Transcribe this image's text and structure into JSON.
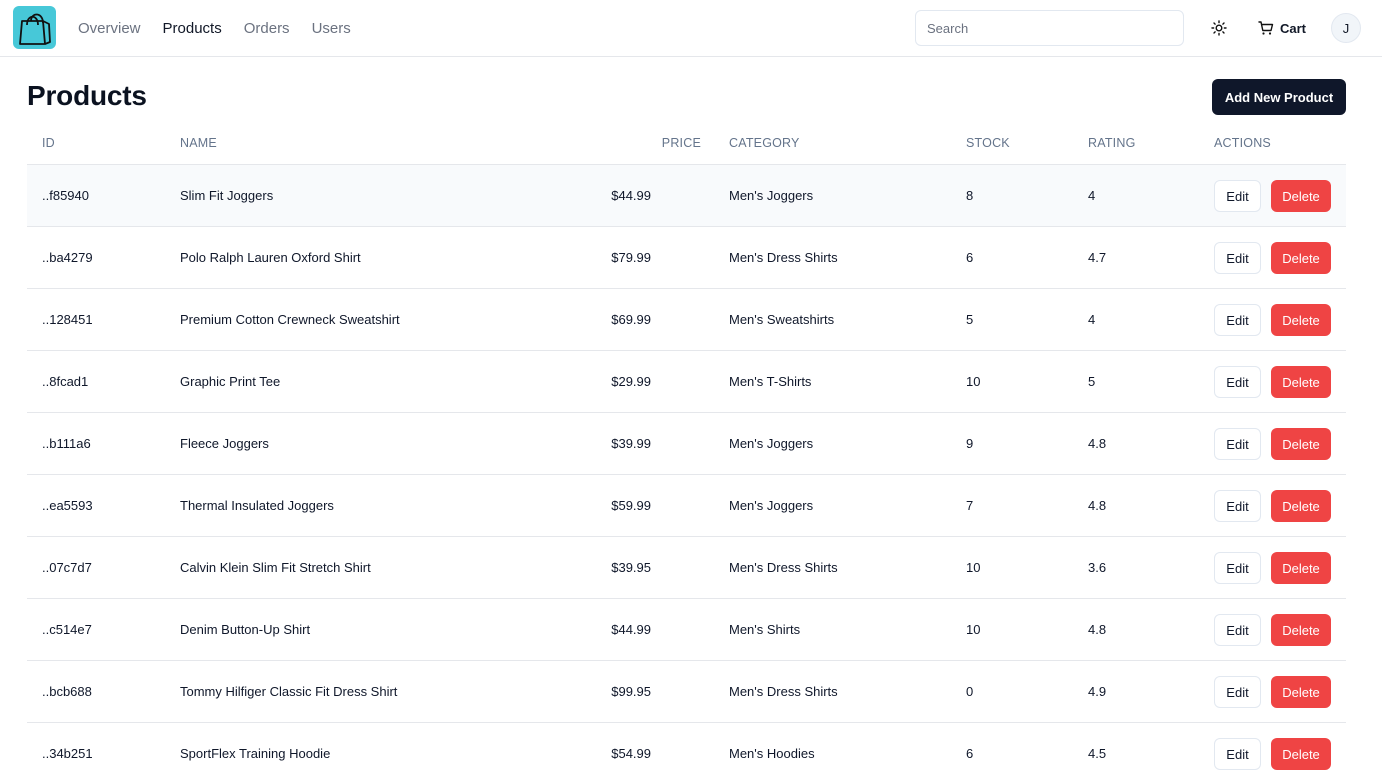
{
  "header": {
    "logo_icon": "shopping-bag-icon",
    "nav": [
      {
        "label": "Overview",
        "active": false
      },
      {
        "label": "Products",
        "active": true
      },
      {
        "label": "Orders",
        "active": false
      },
      {
        "label": "Users",
        "active": false
      }
    ],
    "search_placeholder": "Search",
    "theme_icon": "sun-icon",
    "cart_label": "Cart",
    "avatar_initial": "J"
  },
  "page": {
    "title": "Products",
    "add_button": "Add New Product"
  },
  "table": {
    "columns": [
      "ID",
      "NAME",
      "PRICE",
      "CATEGORY",
      "STOCK",
      "RATING",
      "ACTIONS"
    ],
    "edit_label": "Edit",
    "delete_label": "Delete",
    "rows": [
      {
        "id": "..f85940",
        "name": "Slim Fit Joggers",
        "price": "$44.99",
        "category": "Men's Joggers",
        "stock": "8",
        "rating": "4"
      },
      {
        "id": "..ba4279",
        "name": "Polo Ralph Lauren Oxford Shirt",
        "price": "$79.99",
        "category": "Men's Dress Shirts",
        "stock": "6",
        "rating": "4.7"
      },
      {
        "id": "..128451",
        "name": "Premium Cotton Crewneck Sweatshirt",
        "price": "$69.99",
        "category": "Men's Sweatshirts",
        "stock": "5",
        "rating": "4"
      },
      {
        "id": "..8fcad1",
        "name": "Graphic Print Tee",
        "price": "$29.99",
        "category": "Men's T-Shirts",
        "stock": "10",
        "rating": "5"
      },
      {
        "id": "..b111a6",
        "name": "Fleece Joggers",
        "price": "$39.99",
        "category": "Men's Joggers",
        "stock": "9",
        "rating": "4.8"
      },
      {
        "id": "..ea5593",
        "name": "Thermal Insulated Joggers",
        "price": "$59.99",
        "category": "Men's Joggers",
        "stock": "7",
        "rating": "4.8"
      },
      {
        "id": "..07c7d7",
        "name": "Calvin Klein Slim Fit Stretch Shirt",
        "price": "$39.95",
        "category": "Men's Dress Shirts",
        "stock": "10",
        "rating": "3.6"
      },
      {
        "id": "..c514e7",
        "name": "Denim Button-Up Shirt",
        "price": "$44.99",
        "category": "Men's Shirts",
        "stock": "10",
        "rating": "4.8"
      },
      {
        "id": "..bcb688",
        "name": "Tommy Hilfiger Classic Fit Dress Shirt",
        "price": "$99.95",
        "category": "Men's Dress Shirts",
        "stock": "0",
        "rating": "4.9"
      },
      {
        "id": "..34b251",
        "name": "SportFlex Training Hoodie",
        "price": "$54.99",
        "category": "Men's Hoodies",
        "stock": "6",
        "rating": "4.5"
      }
    ]
  },
  "colors": {
    "accent": "#0f172a",
    "danger": "#ef4444",
    "logo_bg": "#47c8d8"
  }
}
